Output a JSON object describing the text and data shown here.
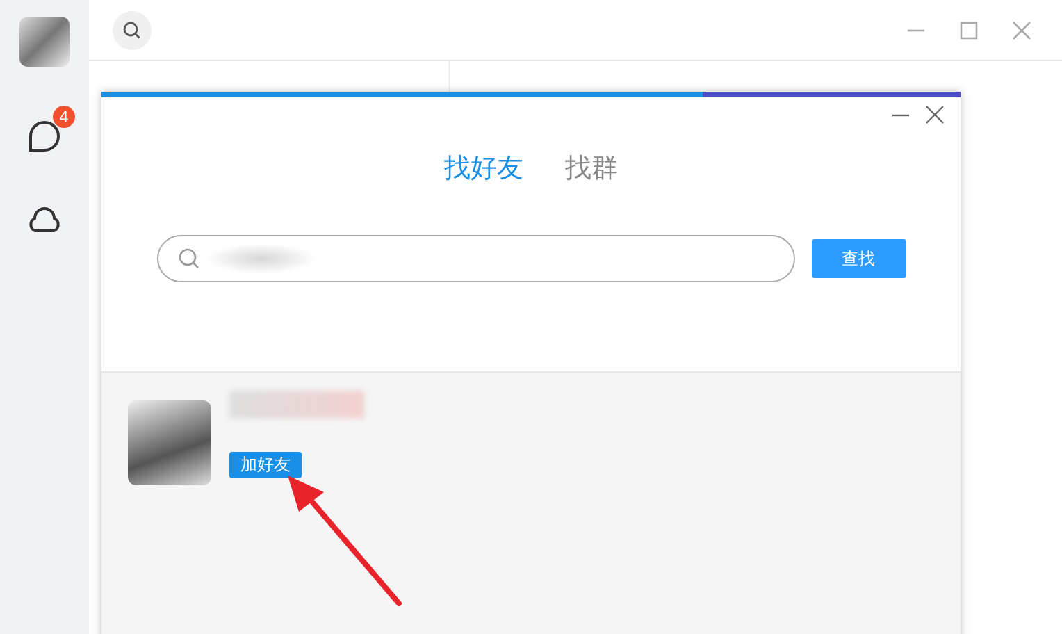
{
  "sidebar": {
    "items": [
      {
        "kind": "avatar"
      },
      {
        "kind": "chat",
        "badge": "4"
      },
      {
        "kind": "cloud"
      }
    ]
  },
  "dialog": {
    "tabs": [
      {
        "label": "找好友",
        "selected": true
      },
      {
        "label": "找群",
        "selected": false
      }
    ],
    "search_button": "查找",
    "result": {
      "add_button": "加好友"
    }
  }
}
